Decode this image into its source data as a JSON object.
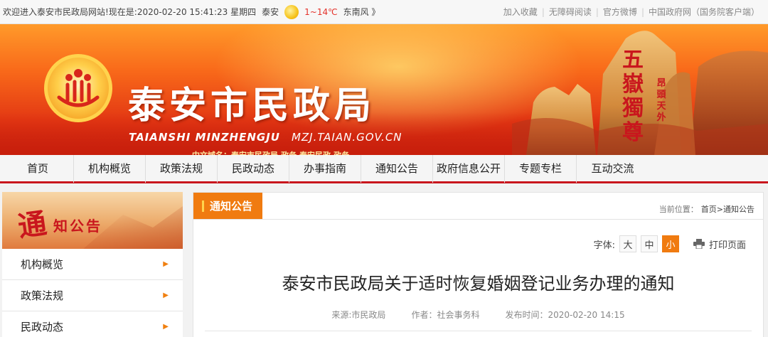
{
  "topbar": {
    "welcome": "欢迎进入泰安市民政局网站!现在是:2020-02-20 15:41:23 星期四",
    "city": "泰安",
    "temperature": "1~14℃",
    "wind": "东南风 》",
    "links": [
      "加入收藏",
      "无障碍阅读",
      "官方微博",
      "中国政府网（国务院客户端）"
    ]
  },
  "banner": {
    "site_name": "泰安市民政局",
    "pinyin": "TAIANSHI MINZHENGJU",
    "url": "MZJ.TAIAN.GOV.CN",
    "domain": "中文域名：泰安市民政局.政务 泰安民政.政务",
    "carving_big": "五嶽獨尊",
    "carving_small": "昂頭天外"
  },
  "nav": [
    "首页",
    "机构概览",
    "政策法规",
    "民政动态",
    "办事指南",
    "通知公告",
    "政府信息公开",
    "专题专栏",
    "互动交流"
  ],
  "sidebar": {
    "brush_char": "通",
    "title": "知公告",
    "items": [
      "机构概览",
      "政策法规",
      "民政动态"
    ]
  },
  "main": {
    "tab": "通知公告",
    "breadcrumb_prefix": "当前位置：",
    "breadcrumb_path": "首页>通知公告",
    "font_label": "字体:",
    "font_sizes": [
      "大",
      "中",
      "小"
    ],
    "print_label": "打印页面",
    "article_title": "泰安市民政局关于适时恢复婚姻登记业务办理的通知",
    "source": "来源:市民政局",
    "author": "作者：社会事务科",
    "published": "发布时间：2020-02-20 14:15"
  },
  "colors": {
    "brand_red": "#c9161d",
    "accent_orange": "#f07b10"
  }
}
